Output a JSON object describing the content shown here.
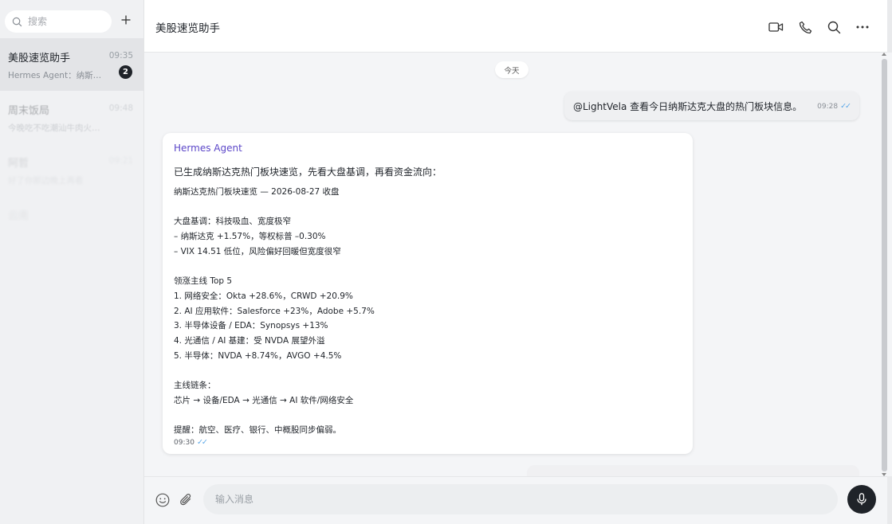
{
  "sidebar": {
    "search_placeholder": "搜索",
    "chats": [
      {
        "name": "美股速览助手",
        "time": "09:35",
        "preview": "Hermes Agent：纳斯…",
        "unread": "2"
      },
      {
        "name": "周末饭局",
        "time": "09:48",
        "preview": "今晚吃不吃潮汕牛肉火锅?"
      },
      {
        "name": "阿哲",
        "time": "09:21",
        "preview": "好了你那边晚上再看"
      },
      {
        "name": "云南",
        "time": "",
        "preview": ""
      },
      {
        "name": "",
        "time": "",
        "preview": ""
      }
    ]
  },
  "header": {
    "title": "美股速览助手",
    "icons": [
      "video-icon",
      "phone-icon",
      "search-icon",
      "more-icon"
    ]
  },
  "messages": {
    "date_label": "今天",
    "outgoing": {
      "text": "@LightVela 查看今日纳斯达克大盘的热门板块信息。",
      "time": "09:28",
      "status": "✓✓"
    },
    "incoming": {
      "sender": "Hermes Agent",
      "intro": "已生成纳斯达克热门板块速览，先看大盘基调，再看资金流向：",
      "lines": [
        "纳斯达克热门板块速览 — 2026-08-27 收盘",
        "",
        "大盘基调：科技吸血、宽度极窄",
        "– 纳斯达克 +1.57%，等权标普 –0.30%",
        "– VIX 14.51 低位，风险偏好回暖但宽度很窄",
        "",
        "领涨主线 Top 5",
        "1. 网络安全：Okta +28.6%，CRWD +20.9%",
        "2. AI 应用软件：Salesforce +23%，Adobe +5.7%",
        "3. 半导体设备 / EDA：Synopsys +13%",
        "4. 光通信 / AI 基建：受 NVDA 展望外溢",
        "5. 半导体：NVDA +8.74%，AVGO +4.5%",
        "",
        "主线链条：",
        "芯片 → 设备/EDA → 光通信 → AI 软件/网络安全",
        "",
        "提醒：航空、医疗、银行、中概股同步偏弱。"
      ],
      "time": "09:30",
      "status": "✓✓"
    }
  },
  "composer": {
    "placeholder": "输入消息"
  },
  "colors": {
    "accent_sender": "#5b46c8",
    "read_check": "#58a6e8",
    "mic_button": "#1f2329"
  }
}
